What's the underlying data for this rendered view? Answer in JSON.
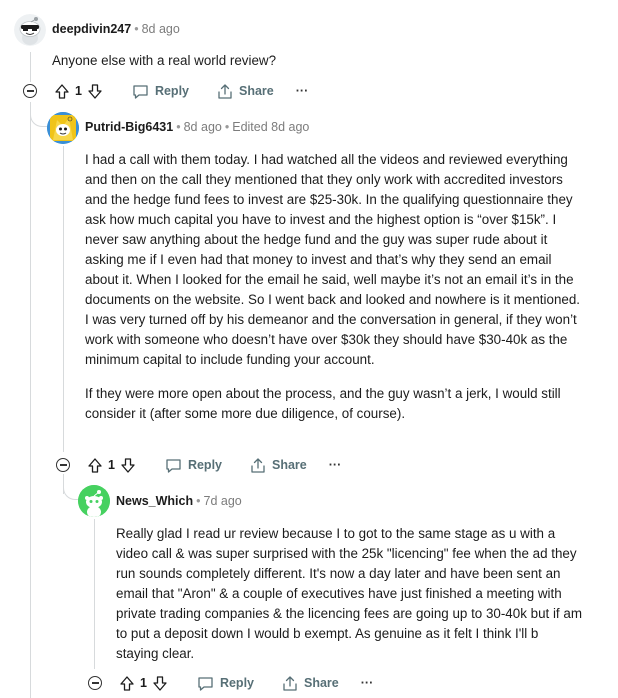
{
  "comments": [
    {
      "author": "deepdivin247",
      "time": "8d ago",
      "edited": "",
      "paragraphs": [
        "Anyone else with a real world review?"
      ],
      "votes": "1",
      "reply_label": "Reply",
      "share_label": "Share",
      "more_label": "···"
    },
    {
      "author": "Putrid-Big6431",
      "time": "8d ago",
      "edited": "Edited 8d ago",
      "paragraphs": [
        "I had a call with them today. I had watched all the videos and reviewed everything and then on the call they mentioned that they only work with accredited investors and the hedge fund fees to invest are $25-30k. In the qualifying questionnaire they ask how much capital you have to invest and the highest option is “over $15k”. I never saw anything about the hedge fund and the guy was super rude about it asking me if I even had that money to invest and that’s why they send an email about it. When I looked for the email he said, well maybe it’s not an email it’s in the documents on the website. So I went back and looked and nowhere is it mentioned. I was very turned off by his demeanor and the conversation in general, if they won’t work with someone who doesn’t have over $30k they should have $30-40k as the minimum capital to include funding your account.",
        "If they were more open about the process, and the guy wasn’t a jerk, I would still consider it (after some more due diligence, of course)."
      ],
      "votes": "1",
      "reply_label": "Reply",
      "share_label": "Share",
      "more_label": "···"
    },
    {
      "author": "News_Which",
      "time": "7d ago",
      "edited": "",
      "paragraphs": [
        "Really glad I read ur review because I to got to the same stage as u with a video call & was super surprised with the 25k \"licencing\" fee when the ad they run sounds completely different. It's now a day later and have been sent an email that \"Aron\" & a couple of executives have just finished a meeting with private trading companies & the licencing fees are going up to 30-40k but if am to put a deposit down I would b exempt.  As genuine as it felt I think I'll b staying clear."
      ],
      "votes": "1",
      "reply_label": "Reply",
      "share_label": "Share",
      "more_label": "···"
    }
  ],
  "colors": {
    "text": "#1c1c1c",
    "meta": "#7c7c7c",
    "action": "#576f76",
    "thread_line": "#d7dadc",
    "avatar1_bg": "#ffffff",
    "avatar2_bg": "#2a8fd6",
    "avatar3_bg": "#46d160"
  },
  "icons": [
    "collapse-icon",
    "upvote-icon",
    "downvote-icon",
    "reply-icon",
    "share-icon",
    "more-icon"
  ]
}
